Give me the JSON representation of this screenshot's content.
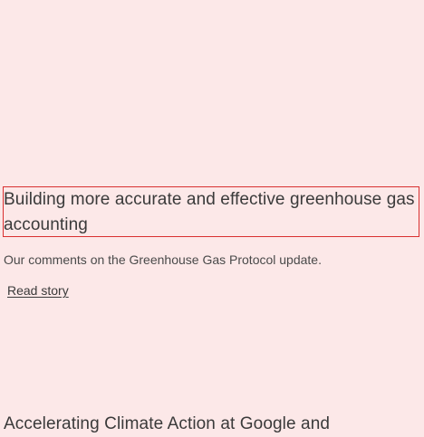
{
  "stories": [
    {
      "title": "Building more accurate and effective greenhouse gas accounting",
      "description": "Our comments on the Greenhouse Gas Protocol update.",
      "link_label": "Read story"
    },
    {
      "title": "Accelerating Climate Action at Google and"
    }
  ],
  "colors": {
    "background": "#fce8e8",
    "focus_outline": "#d93030",
    "text": "#3a3a3a"
  }
}
